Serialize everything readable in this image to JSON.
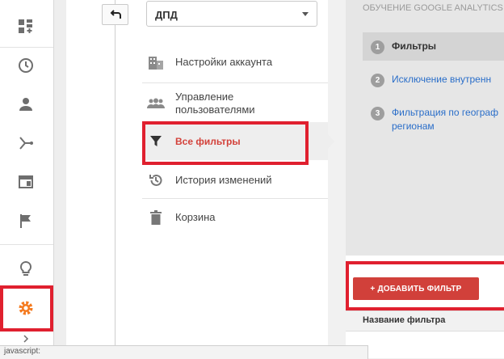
{
  "colors": {
    "accent_red": "#d1403a",
    "highlight_box": "#e0202f",
    "settings_orange": "#f47a1f",
    "link_blue": "#2a6ec9"
  },
  "nav": {
    "icons": [
      "dashboard-add-icon",
      "clock-icon",
      "person-icon",
      "acquisition-icon",
      "content-icon",
      "flag-icon",
      "lightbulb-icon",
      "gear-icon",
      "chevron-right-icon"
    ]
  },
  "header": {
    "back_icon": "back-arrow-icon",
    "account_select_value": "ДПД"
  },
  "menu": {
    "account_settings": "Настройки аккаунта",
    "user_management": "Управление пользователями",
    "all_filters": "Все фильтры",
    "change_history": "История изменений",
    "trash": "Корзина"
  },
  "right": {
    "title": "ОБУЧЕНИЕ GOOGLE ANALYTICS",
    "steps": [
      {
        "num": "1",
        "text": "Фильтры"
      },
      {
        "num": "2",
        "text": "Исключение внутренн"
      },
      {
        "num": "3",
        "text": "Фильтрация по географ",
        "text2": "регионам"
      }
    ],
    "add_filter_button": "+ ДОБАВИТЬ ФИЛЬТР",
    "column_header": "Название фильтра"
  },
  "statusbar": {
    "text": "javascript:"
  }
}
